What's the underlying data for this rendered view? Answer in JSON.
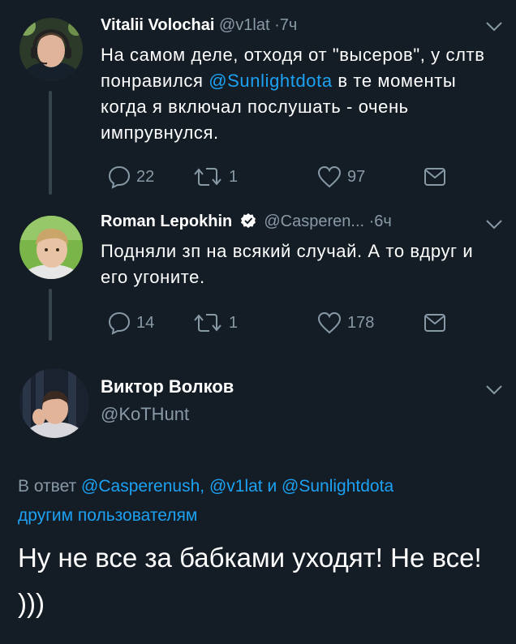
{
  "tweets": [
    {
      "name": "Vitalii Volochai",
      "handle": "@v1lat",
      "time": "7ч",
      "text_before": "На самом деле, отходя от \"высеров\", у слтв понравился ",
      "mention": "@Sunlightdota",
      "text_after": " в те моменты когда я включал послушать - очень импрувнулся.",
      "replies": "22",
      "retweets": "1",
      "likes": "97"
    },
    {
      "name": "Roman Lepokhin",
      "handle": "@Casperen...",
      "time": "6ч",
      "verified": true,
      "text": "Подняли зп на всякий случай. А то вдруг и его угоните.",
      "replies": "14",
      "retweets": "1",
      "likes": "178"
    }
  ],
  "main_tweet": {
    "name": "Виктор Волков",
    "handle": "@KoTHunt",
    "reply_prefix": "В ответ ",
    "reply_mention_1": "@Casperenush",
    "reply_sep_1": ", ",
    "reply_mention_2": "@v1lat",
    "reply_sep_2": " и ",
    "reply_mention_3": "@Sunlightdota",
    "reply_others": "другим пользователям",
    "text": "Ну не все за бабками уходят! Не все!  )))"
  },
  "colors": {
    "background": "#141d26",
    "accent": "#1da1f2",
    "muted": "#8899a6"
  },
  "icons": [
    "reply-icon",
    "retweet-icon",
    "like-icon",
    "message-icon",
    "chevron-down-icon",
    "verified-icon"
  ]
}
